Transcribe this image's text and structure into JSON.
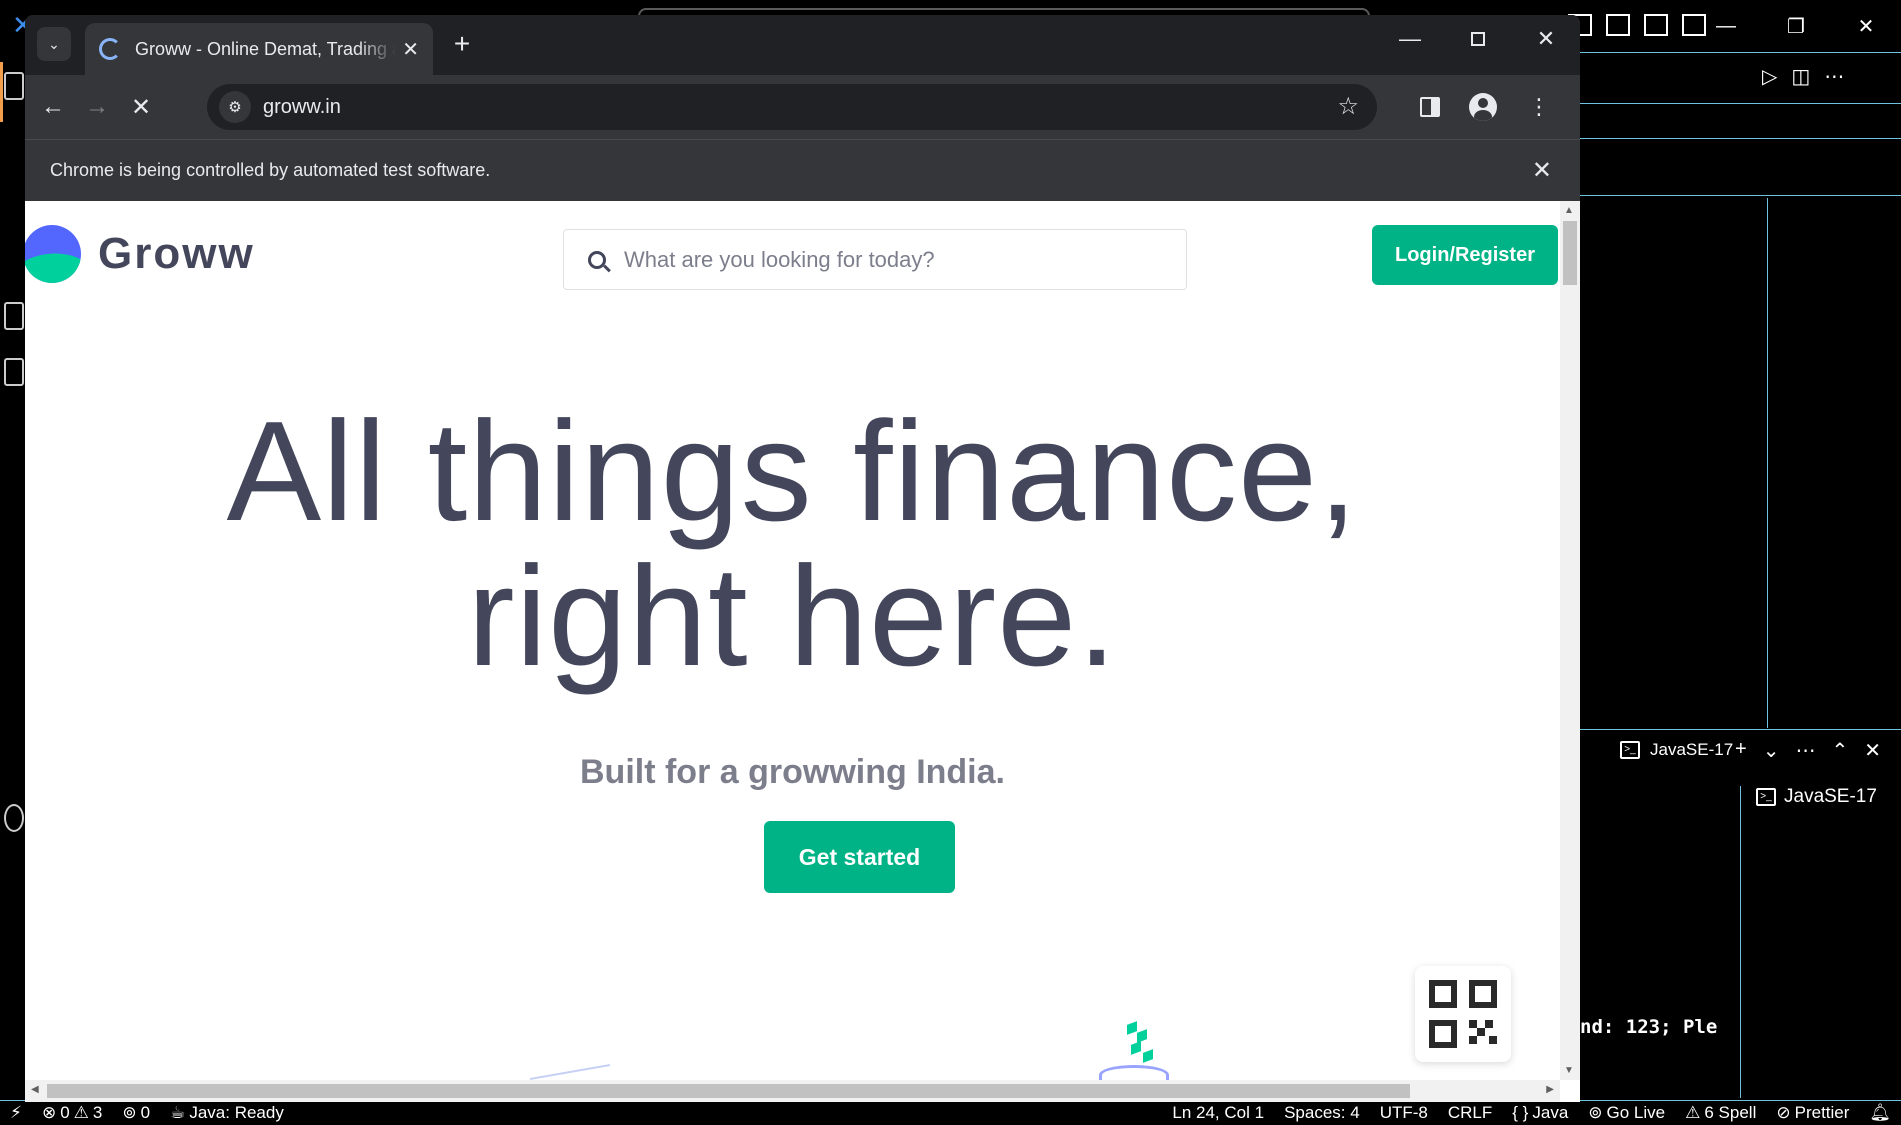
{
  "vscode": {
    "panel": {
      "terminal_label": "JavaSE-17",
      "terminal_list_item": "JavaSE-17",
      "terminal_output": "nd: 123; Ple"
    },
    "status": {
      "errors": "0",
      "warnings": "3",
      "ports": "0",
      "java_status": "Java: Ready",
      "cursor": "Ln 24, Col 1",
      "spaces": "Spaces: 4",
      "encoding": "UTF-8",
      "eol": "CRLF",
      "language": "Java",
      "golive": "Go Live",
      "spell": "6 Spell",
      "prettier": "Prettier"
    }
  },
  "chrome": {
    "tab_title": "Groww - Online Demat, Trading and Direct Mutual Fund",
    "url": "groww.in",
    "infobar_text": "Chrome is being controlled by automated test software."
  },
  "page": {
    "brand": "Groww",
    "search_placeholder": "What are you looking for today?",
    "login_label": "Login/Register",
    "hero_line1": "All things finance,",
    "hero_line2": "right here.",
    "subtitle": "Built for a growwing India.",
    "cta_label": "Get started"
  },
  "colors": {
    "brand_green": "#00b386",
    "brand_blue": "#5367ff",
    "text_dark": "#44475b",
    "text_muted": "#7c7e8c",
    "chrome_dark": "#202124",
    "chrome_toolbar": "#35363a",
    "vscode_accent": "#6fc3df"
  },
  "icons": [
    "search-icon",
    "back-arrow-icon",
    "forward-arrow-icon",
    "stop-loading-icon",
    "site-info-icon",
    "star-icon",
    "side-panel-icon",
    "profile-icon",
    "kebab-menu-icon",
    "close-icon",
    "qr-code-icon"
  ]
}
